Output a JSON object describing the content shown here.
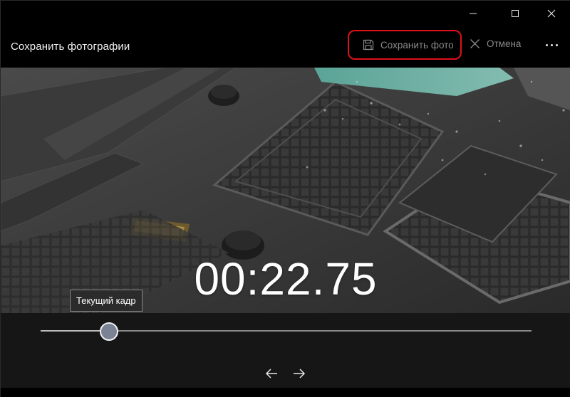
{
  "window": {
    "controls": [
      "minimize",
      "maximize",
      "close"
    ]
  },
  "commandbar": {
    "title": "Сохранить фотографии",
    "save_label": "Сохранить фото",
    "cancel_label": "Отмена",
    "save_icon": "floppy-disk-icon",
    "cancel_icon": "close-icon",
    "more_icon": "more-dots-icon",
    "save_highlight_color": "#e0101a"
  },
  "player": {
    "timecode": "00:22.75",
    "tooltip": "Текущий кадр",
    "position": 0.14,
    "prev_icon": "arrow-left-icon",
    "next_icon": "arrow-right-icon"
  }
}
